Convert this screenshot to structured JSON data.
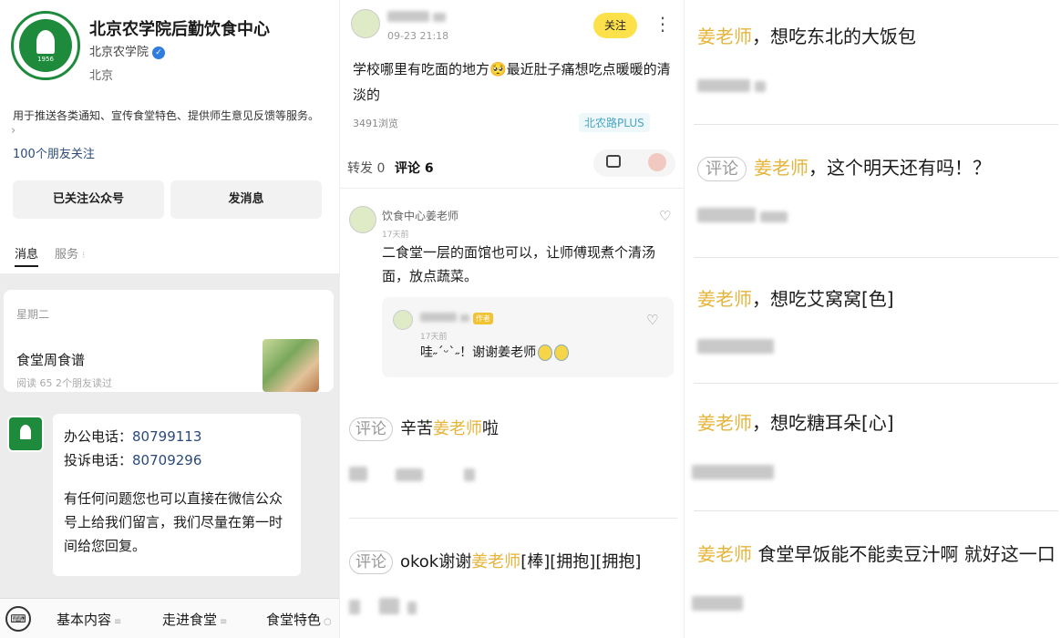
{
  "account": {
    "name": "北京农学院后勤饮食中心",
    "org": "北京农学院",
    "location": "北京",
    "description": "用于推送各类通知、宣传食堂特色、提供师生意见反馈等服务。",
    "friends_following": "100个朋友关注",
    "logo_year": "1956",
    "buttons": {
      "followed": "已关注公众号",
      "message": "发消息"
    },
    "tabs": {
      "messages": "消息",
      "services": "服务"
    },
    "feed": {
      "weekday": "星期二",
      "title": "食堂周食谱",
      "stats": "阅读 65  2个朋友读过"
    },
    "auto_reply": {
      "office_label": "办公电话：",
      "office_phone": "80799113",
      "complaint_label": "投诉电话：",
      "complaint_phone": "80709296",
      "text": "有任何问题您也可以直接在微信公众号上给我们留言，我们尽量在第一时间给您回复。"
    },
    "menu": [
      "基本内容",
      "走进食堂",
      "食堂特色"
    ]
  },
  "post": {
    "time": "09-23 21:18",
    "follow": "关注",
    "text": "学校哪里有吃面的地方🥺最近肚子痛想吃点暖暖的清淡的",
    "views": "3491浏览",
    "tag": "北农路PLUS",
    "tab_repost": "转发 0",
    "tab_comment": "评论 6",
    "comment": {
      "name": "饮食中心姜老师",
      "time": "17天前",
      "text": "二食堂一层的面馆也可以，让师傅现煮个清汤面，放点蔬菜。",
      "reply": {
        "author_badge": "作者",
        "time": "17天前",
        "text": "哇˶ˊᵕˋ˶！谢谢姜老师"
      }
    },
    "entries": [
      {
        "tag": "评论",
        "pre": "辛苦",
        "hl": "姜老师",
        "post": "啦"
      },
      {
        "tag": "评论",
        "pre": "okok谢谢",
        "hl": "姜老师",
        "post": "[棒][拥抱][拥抱]"
      }
    ]
  },
  "messages": [
    {
      "tag": "",
      "hl": "姜老师",
      "text": "，想吃东北的大饭包"
    },
    {
      "tag": "评论",
      "hl": "姜老师",
      "text": "，这个明天还有吗！？"
    },
    {
      "tag": "",
      "hl": "姜老师",
      "text": "，想吃艾窝窝[色]"
    },
    {
      "tag": "",
      "hl": "姜老师",
      "text": "，想吃糖耳朵[心]"
    },
    {
      "tag": "",
      "hl": "姜老师",
      "text": " 食堂早饭能不能卖豆汁啊 就好这一口"
    }
  ]
}
